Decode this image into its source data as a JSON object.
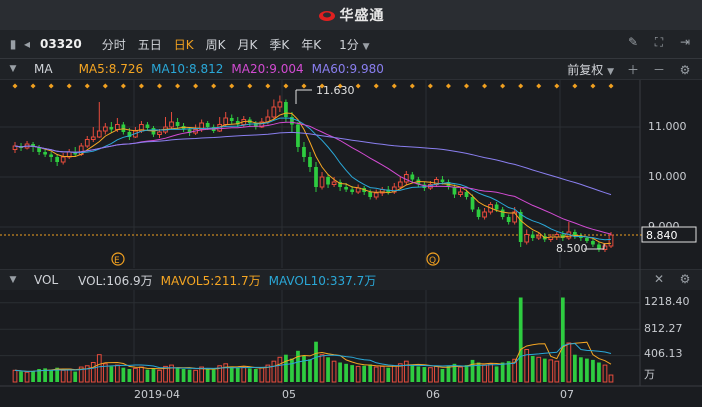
{
  "app": {
    "title": "华盛通"
  },
  "toolbar": {
    "stock_code": "03320",
    "periods": [
      {
        "label": "分时",
        "active": false
      },
      {
        "label": "五日",
        "active": false
      },
      {
        "label": "日K",
        "active": true
      },
      {
        "label": "周K",
        "active": false
      },
      {
        "label": "月K",
        "active": false
      },
      {
        "label": "季K",
        "active": false
      },
      {
        "label": "年K",
        "active": false
      }
    ],
    "interval": "1分"
  },
  "ma_header": {
    "name": "MA",
    "ma5": "MA5:8.726",
    "ma10": "MA10:8.812",
    "ma20": "MA20:9.004",
    "ma60": "MA60:9.980",
    "adjust": "前复权"
  },
  "vol_header": {
    "name": "VOL",
    "vol": "VOL:106.9万",
    "mavol5": "MAVOL5:211.7万",
    "mavol10": "MAVOL10:337.7万"
  },
  "price_axis": {
    "labels": [
      "11.000",
      "10.000",
      "9.000"
    ],
    "current": "8.840"
  },
  "vol_axis": {
    "labels": [
      "1218.40",
      "812.27",
      "406.13"
    ],
    "unit": "万"
  },
  "x_axis": {
    "labels": [
      "2019-04",
      "05",
      "06",
      "07"
    ]
  },
  "annotations": {
    "high": "11.630",
    "low": "8.500",
    "events": [
      "E",
      "Q"
    ]
  },
  "colors": {
    "up": "#e74c3c",
    "down": "#2ecc40",
    "ma5": "#f5a623",
    "ma10": "#2aa8d8",
    "ma20": "#d24bd2",
    "ma60": "#8a7ff0",
    "accent": "#f0a020"
  },
  "chart_data": {
    "type": "candlestick",
    "price_range": [
      8.3,
      11.9
    ],
    "volume_range": [
      0,
      1400
    ],
    "volume_unit": "万",
    "candles": [
      [
        10.55,
        10.62,
        10.7,
        10.48,
        180
      ],
      [
        10.62,
        10.58,
        10.68,
        10.52,
        160
      ],
      [
        10.58,
        10.66,
        10.72,
        10.55,
        150
      ],
      [
        10.66,
        10.6,
        10.7,
        10.5,
        170
      ],
      [
        10.6,
        10.5,
        10.64,
        10.44,
        200
      ],
      [
        10.5,
        10.45,
        10.58,
        10.4,
        210
      ],
      [
        10.45,
        10.4,
        10.5,
        10.3,
        190
      ],
      [
        10.4,
        10.3,
        10.45,
        10.22,
        220
      ],
      [
        10.3,
        10.4,
        10.48,
        10.25,
        180
      ],
      [
        10.4,
        10.5,
        10.56,
        10.36,
        200
      ],
      [
        10.5,
        10.45,
        10.6,
        10.4,
        160
      ],
      [
        10.45,
        10.62,
        10.68,
        10.42,
        230
      ],
      [
        10.62,
        10.75,
        10.82,
        10.58,
        250
      ],
      [
        10.75,
        10.8,
        11.0,
        10.7,
        300
      ],
      [
        10.8,
        10.92,
        11.5,
        10.78,
        420
      ],
      [
        10.92,
        11.0,
        11.08,
        10.85,
        280
      ],
      [
        11.0,
        10.95,
        11.1,
        10.88,
        240
      ],
      [
        10.95,
        11.05,
        11.18,
        10.9,
        260
      ],
      [
        11.05,
        10.9,
        11.1,
        10.85,
        220
      ],
      [
        10.9,
        10.8,
        10.98,
        10.74,
        200
      ],
      [
        10.8,
        10.92,
        11.0,
        10.78,
        210
      ],
      [
        10.92,
        11.05,
        11.12,
        10.88,
        230
      ],
      [
        11.05,
        10.98,
        11.1,
        10.92,
        190
      ],
      [
        10.98,
        10.85,
        11.02,
        10.8,
        210
      ],
      [
        10.85,
        10.9,
        10.96,
        10.78,
        180
      ],
      [
        10.9,
        11.0,
        11.2,
        10.86,
        240
      ],
      [
        11.0,
        11.1,
        11.3,
        10.95,
        260
      ],
      [
        11.1,
        11.02,
        11.18,
        10.96,
        220
      ],
      [
        11.02,
        10.95,
        11.08,
        10.9,
        200
      ],
      [
        10.95,
        10.88,
        11.0,
        10.82,
        190
      ],
      [
        10.88,
        10.95,
        11.05,
        10.84,
        180
      ],
      [
        10.95,
        11.08,
        11.15,
        10.9,
        230
      ],
      [
        11.08,
        11.0,
        11.12,
        10.94,
        200
      ],
      [
        11.0,
        10.92,
        11.05,
        10.88,
        190
      ],
      [
        10.92,
        11.05,
        11.2,
        10.9,
        250
      ],
      [
        11.05,
        11.18,
        11.3,
        11.0,
        280
      ],
      [
        11.18,
        11.12,
        11.25,
        11.05,
        240
      ],
      [
        11.12,
        11.05,
        11.2,
        11.0,
        220
      ],
      [
        11.05,
        11.15,
        11.22,
        11.0,
        230
      ],
      [
        11.15,
        11.08,
        11.2,
        11.02,
        210
      ],
      [
        11.08,
        11.0,
        11.12,
        10.95,
        200
      ],
      [
        11.0,
        11.1,
        11.18,
        10.98,
        220
      ],
      [
        11.1,
        11.2,
        11.35,
        11.05,
        260
      ],
      [
        11.2,
        11.4,
        11.55,
        11.15,
        320
      ],
      [
        11.4,
        11.5,
        11.63,
        11.3,
        380
      ],
      [
        11.5,
        11.2,
        11.55,
        11.1,
        420
      ],
      [
        11.2,
        11.05,
        11.3,
        10.9,
        360
      ],
      [
        11.05,
        10.6,
        11.1,
        10.5,
        480
      ],
      [
        10.6,
        10.4,
        10.7,
        10.3,
        400
      ],
      [
        10.4,
        10.2,
        10.5,
        10.1,
        350
      ],
      [
        10.2,
        9.8,
        10.3,
        9.7,
        620
      ],
      [
        9.8,
        10.0,
        10.1,
        9.75,
        420
      ],
      [
        10.0,
        9.85,
        10.05,
        9.78,
        380
      ],
      [
        9.85,
        9.9,
        10.0,
        9.8,
        320
      ],
      [
        9.9,
        9.8,
        9.95,
        9.72,
        300
      ],
      [
        9.8,
        9.75,
        9.88,
        9.7,
        280
      ],
      [
        9.75,
        9.7,
        9.82,
        9.65,
        260
      ],
      [
        9.7,
        9.78,
        9.85,
        9.66,
        240
      ],
      [
        9.78,
        9.7,
        9.82,
        9.64,
        250
      ],
      [
        9.7,
        9.6,
        9.75,
        9.55,
        270
      ],
      [
        9.6,
        9.68,
        9.75,
        9.55,
        230
      ],
      [
        9.68,
        9.75,
        9.8,
        9.62,
        240
      ],
      [
        9.75,
        9.7,
        9.82,
        9.65,
        220
      ],
      [
        9.7,
        9.8,
        9.88,
        9.66,
        250
      ],
      [
        9.8,
        9.9,
        10.0,
        9.76,
        280
      ],
      [
        9.9,
        10.05,
        10.12,
        9.85,
        320
      ],
      [
        10.05,
        9.95,
        10.1,
        9.9,
        260
      ],
      [
        9.95,
        9.85,
        10.0,
        9.8,
        240
      ],
      [
        9.85,
        9.78,
        9.9,
        9.72,
        230
      ],
      [
        9.78,
        9.85,
        9.92,
        9.74,
        220
      ],
      [
        9.85,
        9.95,
        10.0,
        9.8,
        240
      ],
      [
        9.95,
        9.9,
        10.02,
        9.85,
        200
      ],
      [
        9.9,
        9.8,
        9.95,
        9.75,
        250
      ],
      [
        9.8,
        9.65,
        9.85,
        9.58,
        280
      ],
      [
        9.65,
        9.7,
        9.78,
        9.6,
        230
      ],
      [
        9.7,
        9.6,
        9.75,
        9.55,
        260
      ],
      [
        9.6,
        9.35,
        9.65,
        9.3,
        340
      ],
      [
        9.35,
        9.2,
        9.4,
        9.15,
        300
      ],
      [
        9.2,
        9.3,
        9.38,
        9.15,
        260
      ],
      [
        9.3,
        9.45,
        9.5,
        9.25,
        280
      ],
      [
        9.45,
        9.35,
        9.5,
        9.3,
        240
      ],
      [
        9.35,
        9.2,
        9.4,
        9.15,
        300
      ],
      [
        9.2,
        9.1,
        9.25,
        9.05,
        320
      ],
      [
        9.1,
        9.3,
        9.4,
        9.05,
        350
      ],
      [
        9.3,
        8.7,
        9.35,
        8.6,
        1300
      ],
      [
        8.7,
        8.85,
        8.95,
        8.65,
        500
      ],
      [
        8.85,
        8.78,
        8.92,
        8.72,
        400
      ],
      [
        8.78,
        8.82,
        8.9,
        8.74,
        380
      ],
      [
        8.82,
        8.75,
        8.88,
        8.7,
        360
      ],
      [
        8.75,
        8.8,
        8.86,
        8.7,
        340
      ],
      [
        8.8,
        8.85,
        8.9,
        8.74,
        320
      ],
      [
        8.85,
        8.78,
        8.92,
        8.72,
        1300
      ],
      [
        8.78,
        8.9,
        9.1,
        8.74,
        600
      ],
      [
        8.9,
        8.82,
        8.95,
        8.76,
        420
      ],
      [
        8.82,
        8.78,
        8.88,
        8.72,
        380
      ],
      [
        8.78,
        8.72,
        8.82,
        8.68,
        360
      ],
      [
        8.72,
        8.65,
        8.78,
        8.6,
        340
      ],
      [
        8.65,
        8.55,
        8.7,
        8.5,
        300
      ],
      [
        8.55,
        8.62,
        8.68,
        8.5,
        260
      ],
      [
        8.62,
        8.84,
        8.9,
        8.58,
        107
      ]
    ]
  }
}
